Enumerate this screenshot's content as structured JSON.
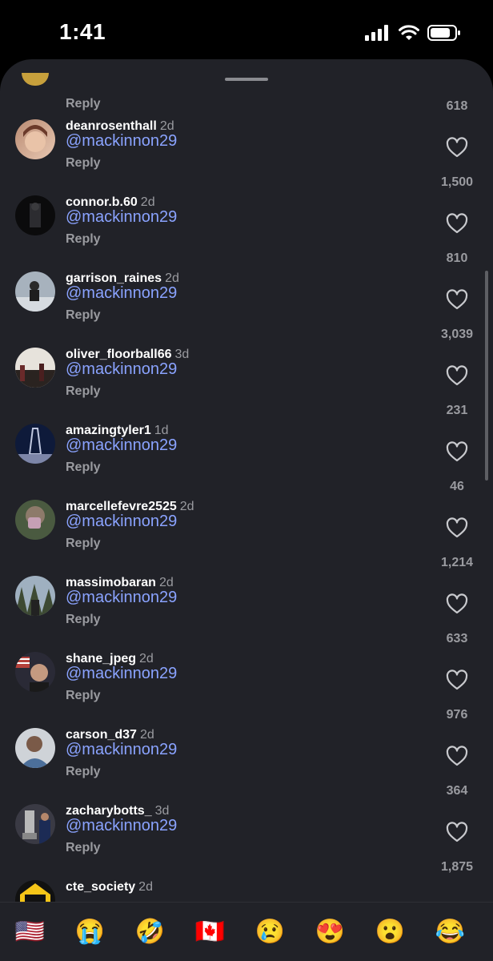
{
  "status": {
    "time": "1:41"
  },
  "partial_top": {
    "reply": "Reply",
    "likes": "618"
  },
  "comments": [
    {
      "username": "deanrosenthall",
      "age": "2d",
      "text": "@mackinnon29",
      "reply": "Reply",
      "likes": "1,500",
      "avatar_colors": [
        "#b98a72",
        "#e8c8b2"
      ]
    },
    {
      "username": "connor.b.60",
      "age": "2d",
      "text": "@mackinnon29",
      "reply": "Reply",
      "likes": "810",
      "avatar_colors": [
        "#0b0b0c",
        "#3a3a3d"
      ]
    },
    {
      "username": "garrison_raines",
      "age": "2d",
      "text": "@mackinnon29",
      "reply": "Reply",
      "likes": "3,039",
      "avatar_colors": [
        "#a7b2bd",
        "#2a2a2a"
      ]
    },
    {
      "username": "oliver_floorball66",
      "age": "3d",
      "text": "@mackinnon29",
      "reply": "Reply",
      "likes": "231",
      "avatar_colors": [
        "#e7e3dc",
        "#6a2a2a"
      ]
    },
    {
      "username": "amazingtyler1",
      "age": "1d",
      "text": "@mackinnon29",
      "reply": "Reply",
      "likes": "46",
      "avatar_colors": [
        "#0e1a3a",
        "#c0c8e0"
      ]
    },
    {
      "username": "marcellefevre2525",
      "age": "2d",
      "text": "@mackinnon29",
      "reply": "Reply",
      "likes": "1,214",
      "avatar_colors": [
        "#4a5a40",
        "#c6a0b5"
      ]
    },
    {
      "username": "massimobaran",
      "age": "2d",
      "text": "@mackinnon29",
      "reply": "Reply",
      "likes": "633",
      "avatar_colors": [
        "#9fb0c0",
        "#3d4a33"
      ]
    },
    {
      "username": "shane_jpeg",
      "age": "2d",
      "text": "@mackinnon29",
      "reply": "Reply",
      "likes": "976",
      "avatar_colors": [
        "#2a2a36",
        "#b5413b"
      ]
    },
    {
      "username": "carson_d37",
      "age": "2d",
      "text": "@mackinnon29",
      "reply": "Reply",
      "likes": "364",
      "avatar_colors": [
        "#4c6f9a",
        "#cfd3d8"
      ]
    },
    {
      "username": "zacharybotts_",
      "age": "3d",
      "text": "@mackinnon29",
      "reply": "Reply",
      "likes": "1,875",
      "avatar_colors": [
        "#1c2b55",
        "#b9b9b9"
      ]
    },
    {
      "username": "cte_society",
      "age": "2d",
      "text": "",
      "reply": "",
      "likes": "",
      "avatar_colors": [
        "#111111",
        "#f5c518"
      ]
    }
  ],
  "reactions": [
    {
      "emoji": "🇺🇸"
    },
    {
      "emoji": "😭"
    },
    {
      "emoji": "🤣"
    },
    {
      "emoji": "🇨🇦"
    },
    {
      "emoji": "😢"
    },
    {
      "emoji": "😍"
    },
    {
      "emoji": "😮"
    },
    {
      "emoji": "😂"
    }
  ],
  "icons": {
    "heart": "heart-outline-icon",
    "signal": "cellular-signal-icon",
    "wifi": "wifi-icon",
    "battery": "battery-icon"
  },
  "colors": {
    "sheet": "#212228",
    "mention": "#8aa3ff",
    "muted": "#9a9ba0"
  }
}
